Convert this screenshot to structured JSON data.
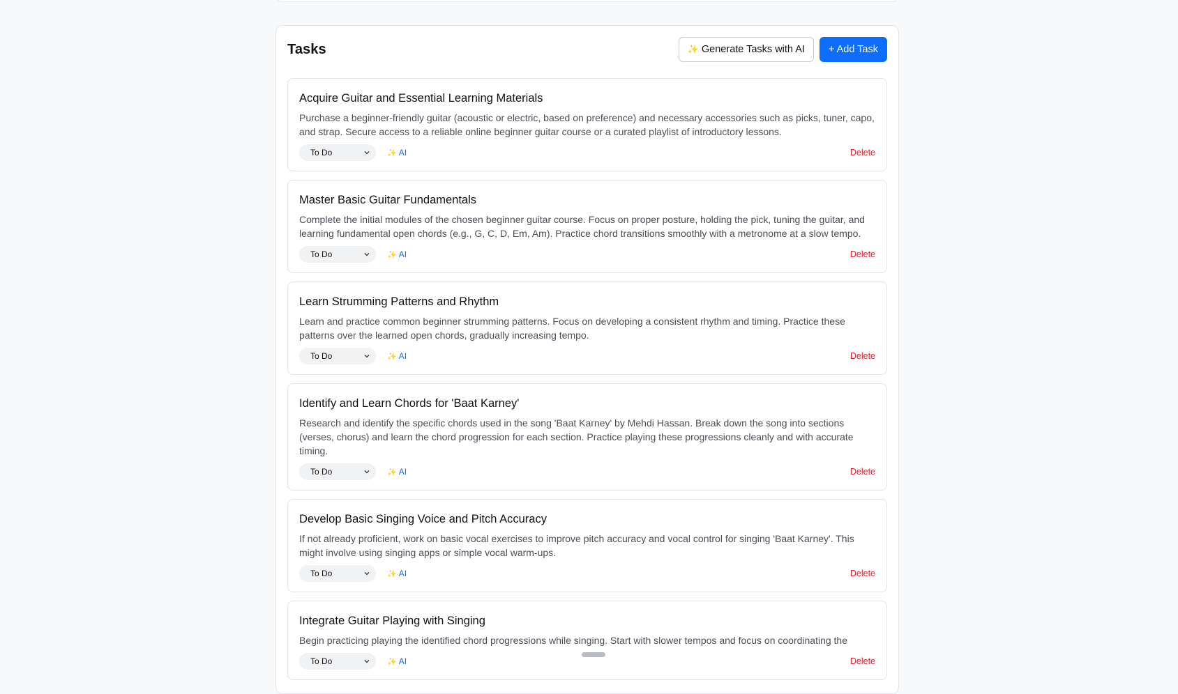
{
  "tasks_panel": {
    "title": "Tasks",
    "generate_label": "Generate Tasks with AI",
    "add_label": "+ Add Task"
  },
  "labels": {
    "ai": "AI",
    "delete": "Delete"
  },
  "tasks": [
    {
      "title": "Acquire Guitar and Essential Learning Materials",
      "description": "Purchase a beginner-friendly guitar (acoustic or electric, based on preference) and necessary accessories such as picks, tuner, capo, and strap. Secure access to a reliable online beginner guitar course or a curated playlist of introductory lessons.",
      "status": "To Do"
    },
    {
      "title": "Master Basic Guitar Fundamentals",
      "description": "Complete the initial modules of the chosen beginner guitar course. Focus on proper posture, holding the pick, tuning the guitar, and learning fundamental open chords (e.g., G, C, D, Em, Am). Practice chord transitions smoothly with a metronome at a slow tempo.",
      "status": "To Do"
    },
    {
      "title": "Learn Strumming Patterns and Rhythm",
      "description": "Learn and practice common beginner strumming patterns. Focus on developing a consistent rhythm and timing. Practice these patterns over the learned open chords, gradually increasing tempo.",
      "status": "To Do"
    },
    {
      "title": "Identify and Learn Chords for 'Baat Karney'",
      "description": "Research and identify the specific chords used in the song 'Baat Karney' by Mehdi Hassan. Break down the song into sections (verses, chorus) and learn the chord progression for each section. Practice playing these progressions cleanly and with accurate timing.",
      "status": "To Do"
    },
    {
      "title": "Develop Basic Singing Voice and Pitch Accuracy",
      "description": "If not already proficient, work on basic vocal exercises to improve pitch accuracy and vocal control for singing 'Baat Karney'. This might involve using singing apps or simple vocal warm-ups.",
      "status": "To Do"
    },
    {
      "title": "Integrate Guitar Playing with Singing",
      "description": "Begin practicing playing the identified chord progressions while singing. Start with slower tempos and focus on coordinating the",
      "status": "To Do"
    }
  ]
}
